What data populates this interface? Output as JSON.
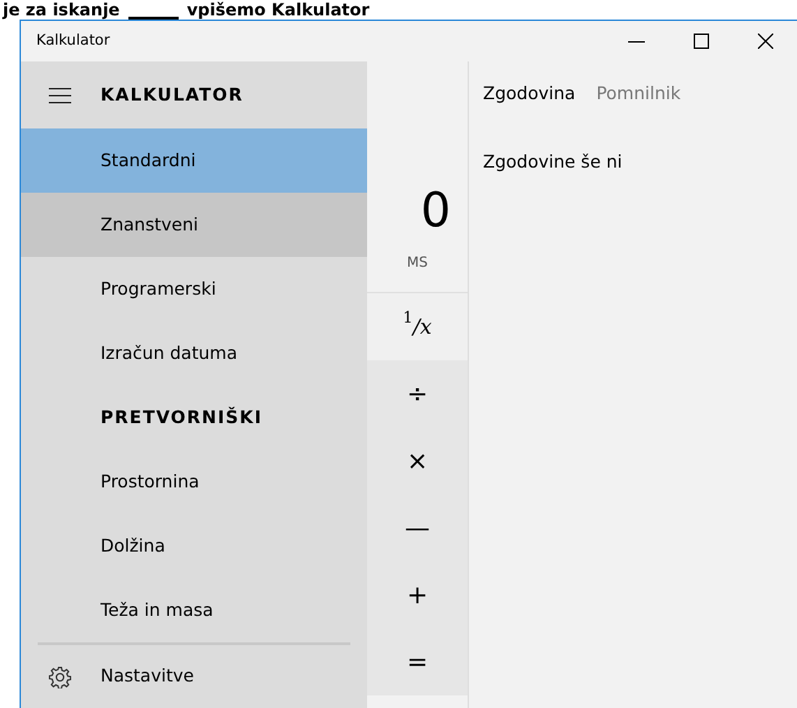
{
  "caption": {
    "before": "je za iskanje",
    "after": "vpišemo Kalkulator"
  },
  "window": {
    "title": "Kalkulator"
  },
  "nav": [
    {
      "kind": "header",
      "label": "KALKULATOR"
    },
    {
      "kind": "item",
      "label": "Standardni",
      "selected": true,
      "hovered": false
    },
    {
      "kind": "item",
      "label": "Znanstveni",
      "selected": false,
      "hovered": true
    },
    {
      "kind": "item",
      "label": "Programerski",
      "selected": false,
      "hovered": false
    },
    {
      "kind": "item",
      "label": "Izračun datuma",
      "selected": false,
      "hovered": false
    },
    {
      "kind": "section",
      "label": "PRETVORNIŠKI"
    },
    {
      "kind": "item",
      "label": "Prostornina",
      "selected": false,
      "hovered": false
    },
    {
      "kind": "item",
      "label": "Dolžina",
      "selected": false,
      "hovered": false
    },
    {
      "kind": "item",
      "label": "Teža in masa",
      "selected": false,
      "hovered": false
    },
    {
      "kind": "settings",
      "label": "Nastavitve"
    }
  ],
  "display": "0",
  "memory_button": "MS",
  "keys": [
    {
      "kind": "fraction",
      "num": "1",
      "den": "/x"
    },
    {
      "kind": "text",
      "label": "÷"
    },
    {
      "kind": "text",
      "label": "×"
    },
    {
      "kind": "text",
      "label": "—"
    },
    {
      "kind": "text",
      "label": "+"
    },
    {
      "kind": "text",
      "label": "="
    }
  ],
  "tabs": [
    {
      "label": "Zgodovina",
      "selected": true
    },
    {
      "label": "Pomnilnik",
      "selected": false
    }
  ],
  "history_empty": "Zgodovine še ni"
}
